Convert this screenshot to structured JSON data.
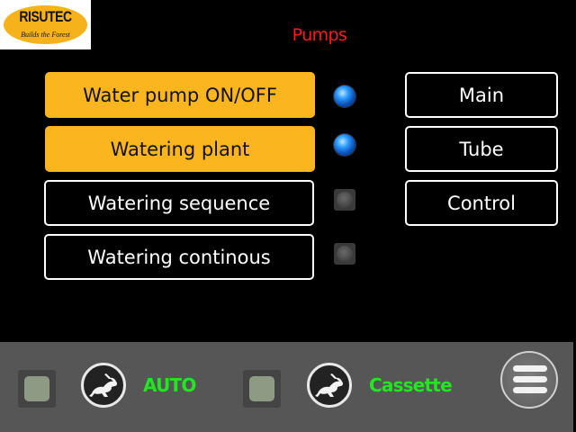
{
  "logo": {
    "brand": "RISUTEC",
    "slogan": "Builds the Forest"
  },
  "header": {
    "title": "Pumps"
  },
  "functions": [
    {
      "label": "Water pump ON/OFF",
      "active": true,
      "led": "on"
    },
    {
      "label": "Watering plant",
      "active": true,
      "led": "on"
    },
    {
      "label": "Watering sequence",
      "active": false,
      "led": "off"
    },
    {
      "label": "Watering continous",
      "active": false,
      "led": "off"
    }
  ],
  "nav": [
    {
      "label": "Main"
    },
    {
      "label": "Tube"
    },
    {
      "label": "Control"
    }
  ],
  "footer": {
    "mode1": {
      "label": "AUTO",
      "icon": "rabbit-icon"
    },
    "mode2": {
      "label": "Cassette",
      "icon": "rabbit-icon"
    },
    "menu_icon": "hamburger-menu-icon"
  },
  "colors": {
    "accent": "#fbb61f",
    "title_red": "#ff1a1a",
    "mode_green": "#22e622",
    "led_on": "#2b9bff",
    "footer_bg": "#565656"
  }
}
